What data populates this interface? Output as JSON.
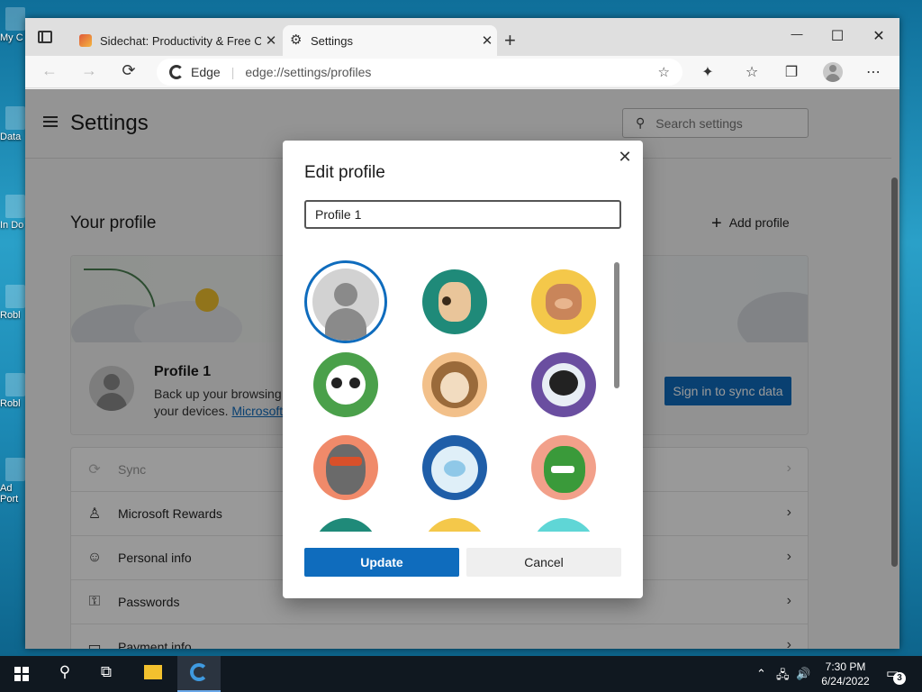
{
  "desktop": {
    "icons": [
      {
        "label": "My C"
      },
      {
        "label": "Data"
      },
      {
        "label": "In Do"
      },
      {
        "label": "Robl"
      },
      {
        "label": "Robl"
      },
      {
        "label": "Ad Port"
      }
    ]
  },
  "browser": {
    "tabs": [
      {
        "title": "Sidechat: Productivity & Free Ch",
        "close": "✕"
      },
      {
        "title": "Settings",
        "close": "✕"
      }
    ],
    "new_tab": "+",
    "window_controls": {
      "minimize": "—",
      "maximize": "☐",
      "close": "✕"
    },
    "address": {
      "site_name": "Edge",
      "url": "edge://settings/profiles"
    },
    "toolbar_icons": [
      "extensions-icon",
      "favorites-icon",
      "collections-icon",
      "profile-icon",
      "more-icon"
    ]
  },
  "settings": {
    "title": "Settings",
    "search_placeholder": "Search settings",
    "your_profile": "Your profile",
    "add_profile": "Add profile",
    "profile": {
      "name": "Profile 1",
      "desc_line1": "Back up your browsing",
      "desc_line2": "your devices.",
      "desc_link": "Microsoft",
      "sync_button": "Sign in to sync data"
    },
    "menu": [
      {
        "label": "Sync",
        "icon": "sync-icon",
        "glyph": "⟳",
        "disabled": true
      },
      {
        "label": "Microsoft Rewards",
        "icon": "trophy-icon",
        "glyph": "♙",
        "disabled": false
      },
      {
        "label": "Personal info",
        "icon": "personal-info-icon",
        "glyph": "☺",
        "disabled": false
      },
      {
        "label": "Passwords",
        "icon": "key-icon",
        "glyph": "⚿",
        "disabled": false
      },
      {
        "label": "Payment info",
        "icon": "card-icon",
        "glyph": "▭",
        "disabled": false
      }
    ]
  },
  "dialog": {
    "title": "Edit profile",
    "name_value": "Profile 1",
    "update": "Update",
    "cancel": "Cancel",
    "avatars": [
      {
        "name": "default-person-avatar",
        "bg": "#d2d2d2",
        "selected": true
      },
      {
        "name": "dog-avatar",
        "bg": "#1f8a79"
      },
      {
        "name": "cat-avatar",
        "bg": "#f4c84a"
      },
      {
        "name": "panda-avatar",
        "bg": "#4aa04a"
      },
      {
        "name": "hedgehog-avatar",
        "bg": "#f2c08a"
      },
      {
        "name": "astronaut-avatar",
        "bg": "#6a4ea0"
      },
      {
        "name": "ninja-avatar",
        "bg": "#f08a6a"
      },
      {
        "name": "yeti-avatar",
        "bg": "#1f5ea8"
      },
      {
        "name": "dinosaur-avatar",
        "bg": "#f2a08a"
      },
      {
        "name": "teal-avatar",
        "bg": "#1f8a79"
      },
      {
        "name": "yellow-avatar",
        "bg": "#f4c84a"
      },
      {
        "name": "aqua-avatar",
        "bg": "#5fd6d6"
      }
    ]
  },
  "taskbar": {
    "time": "7:30 PM",
    "date": "6/24/2022",
    "notifications": "3"
  }
}
